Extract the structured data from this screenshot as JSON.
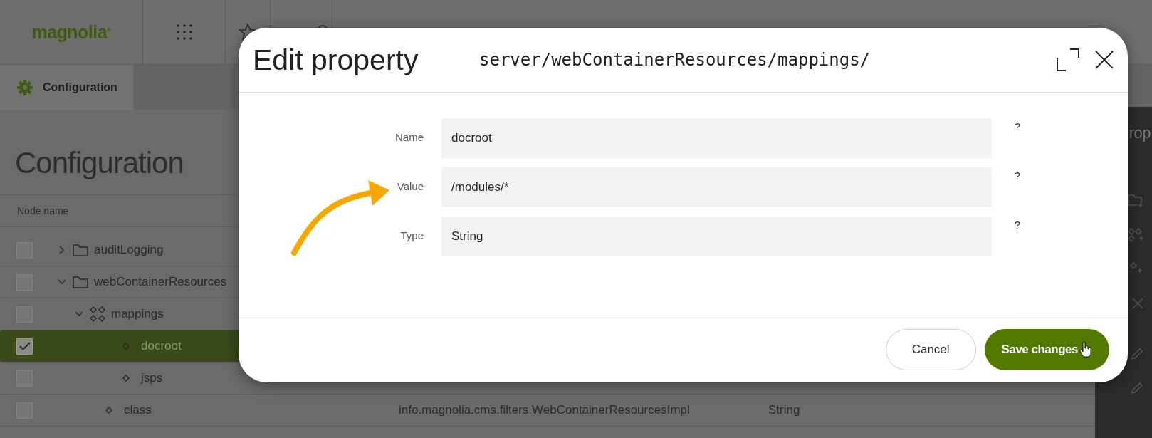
{
  "header": {
    "logo": "magnolia$^{®}$"
  },
  "tabs": [
    {
      "label": "Configuration",
      "selected": true
    }
  ],
  "title": "Configuration",
  "table": {
    "columns": [
      "Node name"
    ],
    "rows": [
      {
        "name": "auditLogging",
        "kind": "folder",
        "expanded": false,
        "checked": false,
        "selected": false
      },
      {
        "name": "webContainerResources",
        "kind": "folder",
        "expanded": true,
        "checked": false,
        "selected": false,
        "children": [
          {
            "name": "mappings",
            "kind": "content",
            "expanded": true,
            "checked": false,
            "selected": false,
            "children": [
              {
                "name": "docroot",
                "kind": "property",
                "checked": true,
                "selected": true
              },
              {
                "name": "jsps",
                "kind": "property",
                "checked": false,
                "selected": false
              }
            ]
          },
          {
            "name": "class",
            "kind": "property",
            "checked": false,
            "selected": false,
            "value": "info.magnolia.cms.filters.WebContainerResourcesImpl",
            "type": "String"
          }
        ]
      }
    ]
  },
  "side_panel": {
    "title": "rop"
  },
  "dialog": {
    "title": "Edit property",
    "path": "server/webContainerResources/mappings/",
    "fields": [
      {
        "label": "Name",
        "value": "docroot",
        "help": "?"
      },
      {
        "label": "Value",
        "value": "/modules/*",
        "help": "?"
      },
      {
        "label": "Type",
        "value": "String",
        "help": "?"
      }
    ],
    "buttons": [
      {
        "label": "Cancel",
        "kind": "secondary"
      },
      {
        "label": "Save changes",
        "kind": "primary"
      }
    ]
  }
}
